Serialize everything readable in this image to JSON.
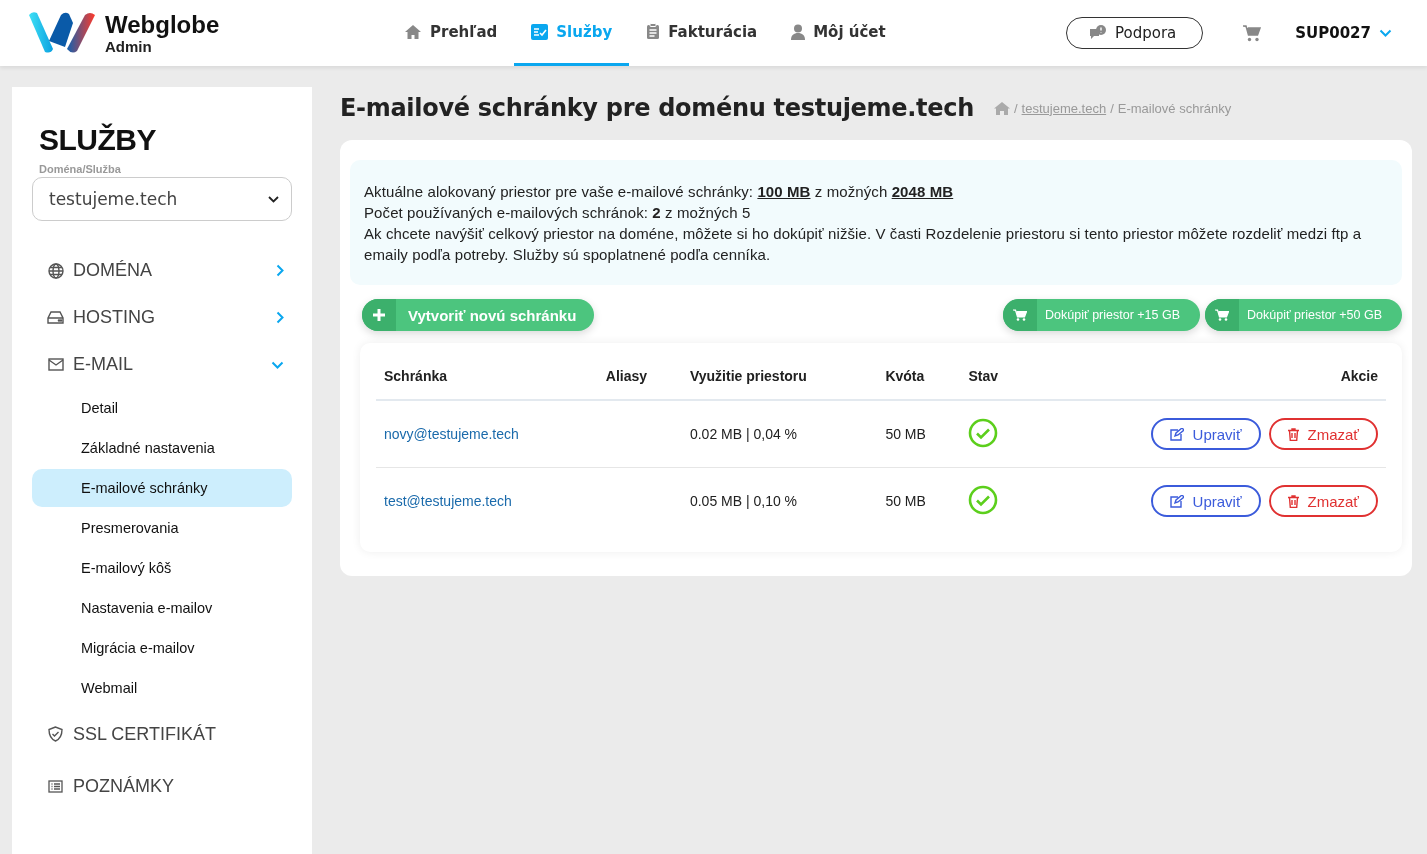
{
  "header": {
    "brand": "Webglobe",
    "brand_sub": "Admin",
    "nav": [
      {
        "label": "Prehľad",
        "selected": false
      },
      {
        "label": "Služby",
        "selected": true
      },
      {
        "label": "Fakturácia",
        "selected": false
      },
      {
        "label": "Môj účet",
        "selected": false
      }
    ],
    "support_button": "Podpora",
    "account": "SUP0027"
  },
  "sidebar": {
    "title": "SLUŽBY",
    "select_label": "Doména/Služba",
    "select_value": "testujeme.tech",
    "sections": [
      {
        "label": "DOMÉNA",
        "kind": "group",
        "expanded": false
      },
      {
        "label": "HOSTING",
        "kind": "group",
        "expanded": false
      },
      {
        "label": "E-MAIL",
        "kind": "group",
        "expanded": true,
        "children": [
          {
            "label": "Detail",
            "selected": false
          },
          {
            "label": "Základné nastavenia",
            "selected": false
          },
          {
            "label": "E-mailové schránky",
            "selected": true
          },
          {
            "label": "Presmerovania",
            "selected": false
          },
          {
            "label": "E-mailový kôš",
            "selected": false
          },
          {
            "label": "Nastavenia e-mailov",
            "selected": false
          },
          {
            "label": "Migrácia e-mailov",
            "selected": false
          },
          {
            "label": "Webmail",
            "selected": false
          }
        ]
      },
      {
        "label": "SSL CERTIFIKÁT",
        "kind": "link"
      },
      {
        "label": "POZNÁMKY",
        "kind": "link"
      }
    ]
  },
  "page": {
    "title": "E-mailové schránky pre doménu testujeme.tech",
    "breadcrumb": [
      {
        "separator": "/",
        "label": "testujeme.tech",
        "kind": "link"
      },
      {
        "separator": "/",
        "label": "E-mailové schránky",
        "kind": "current"
      }
    ]
  },
  "info": {
    "lines": [
      "Aktuálne alokovaný priestor pre vaše e-mailové schránky: **100 MB** z možných **2048 MB**",
      "Počet používaných e-mailových schránok: **2** z možných 5",
      "Ak chcete navýšiť celkový priestor na doméne, môžete si ho dokúpiť nižšie. V časti Rozdelenie priestoru si tento priestor môžete rozdeliť medzi ftp a emaily podľa potreby. Služby sú spoplatnené podľa cenníka."
    ]
  },
  "create_button": "Vytvoriť novú schránku",
  "buy_buttons": [
    "Dokúpiť priestor +15 GB",
    "Dokúpiť priestor +50 GB"
  ],
  "table": {
    "columns": [
      "Schránka",
      "Aliasy",
      "Využitie priestoru",
      "Kvóta",
      "Stav",
      "Akcie"
    ],
    "rows": [
      {
        "mailbox": "novy@testujeme.tech",
        "usage": "0.02 MB | 0,04 %",
        "quota": "50 MB",
        "active": true,
        "edit": "Upraviť",
        "delete": "Zmazať"
      },
      {
        "mailbox": "test@testujeme.tech",
        "usage": "0.05 MB | 0,10 %",
        "quota": "50 MB",
        "active": true,
        "edit": "Upraviť",
        "delete": "Zmazať"
      }
    ]
  }
}
